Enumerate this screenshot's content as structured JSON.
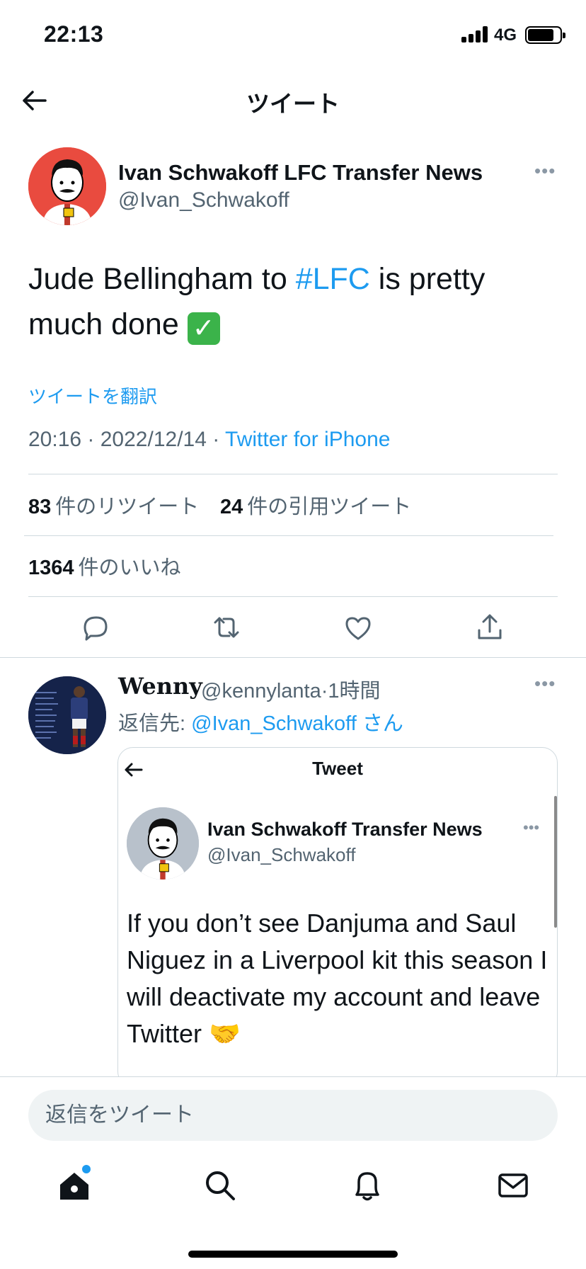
{
  "status_bar": {
    "time": "22:13",
    "network": "4G"
  },
  "header": {
    "title": "ツイート"
  },
  "tweet": {
    "author_name": "Ivan Schwakoff LFC Transfer News",
    "author_handle": "@Ivan_Schwakoff",
    "text_before": "Jude Bellingham to ",
    "hashtag": "#LFC",
    "text_after": " is pretty much done",
    "emoji": "✓",
    "translate_label": "ツイートを翻訳",
    "time": "20:16",
    "date": "2022/12/14",
    "source": "Twitter for iPhone",
    "retweets_count": "83",
    "retweets_label": "件のリツイート",
    "quotes_count": "24",
    "quotes_label": "件の引用ツイート",
    "likes_count": "1364",
    "likes_label": "件のいいね"
  },
  "reply": {
    "name": "Wenny",
    "handle": "@kennylanta",
    "time": "1時間",
    "replying_prefix": "返信先: ",
    "replying_to": "@Ivan_Schwakoff",
    "replying_suffix": " さん",
    "embed": {
      "title": "Tweet",
      "author_name": "Ivan Schwakoff Transfer News",
      "author_handle": "@Ivan_Schwakoff",
      "text": "If you don’t see Danjuma and Saul Niguez in a Liverpool kit this season I will deactivate my account and leave Twitter 🤝"
    }
  },
  "compose": {
    "placeholder": "返信をツイート"
  },
  "colors": {
    "accent": "#1d9bf0",
    "secondary_text": "#536471",
    "divider": "#cfd9de"
  }
}
